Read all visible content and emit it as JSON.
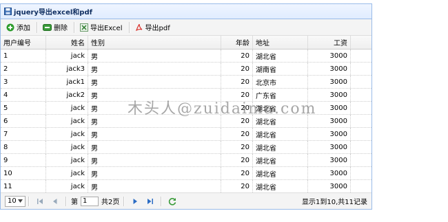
{
  "panel": {
    "title": "jquery导出excel和pdf"
  },
  "toolbar": {
    "add_label": "添加",
    "delete_label": "删除",
    "export_excel_label": "导出Excel",
    "export_pdf_label": "导出pdf"
  },
  "grid": {
    "headers": [
      "用户编号",
      "姓名",
      "性别",
      "年龄",
      "地址",
      "工资"
    ],
    "rows": [
      [
        "1",
        "jack",
        "男",
        "20",
        "湖北省",
        "3000"
      ],
      [
        "2",
        "jack3",
        "男",
        "20",
        "湖南省",
        "3000"
      ],
      [
        "3",
        "jack1",
        "男",
        "20",
        "北京市",
        "3000"
      ],
      [
        "4",
        "jack2",
        "男",
        "20",
        "广东省",
        "3000"
      ],
      [
        "5",
        "jack",
        "男",
        "20",
        "湖北省",
        "3000"
      ],
      [
        "6",
        "jack",
        "男",
        "20",
        "湖北省",
        "3000"
      ],
      [
        "7",
        "jack",
        "男",
        "20",
        "湖北省",
        "3000"
      ],
      [
        "8",
        "jack",
        "男",
        "20",
        "湖北省",
        "3000"
      ],
      [
        "9",
        "jack",
        "男",
        "20",
        "湖北省",
        "3000"
      ],
      [
        "10",
        "jack",
        "男",
        "20",
        "湖北省",
        "3000"
      ],
      [
        "11",
        "jack",
        "男",
        "20",
        "湖北省",
        "3000"
      ]
    ]
  },
  "pager": {
    "page_size": "10",
    "page_prefix": "第",
    "current_page": "1",
    "total_pages": "共2页",
    "info": "显示1到10,共11记录"
  },
  "watermark": "木头人@zuidaima.com",
  "colors": {
    "border": "#99bbe8",
    "title_text": "#0e2d5f",
    "add_icon": "#2e9d2e",
    "pdf_icon": "#d9302a"
  }
}
